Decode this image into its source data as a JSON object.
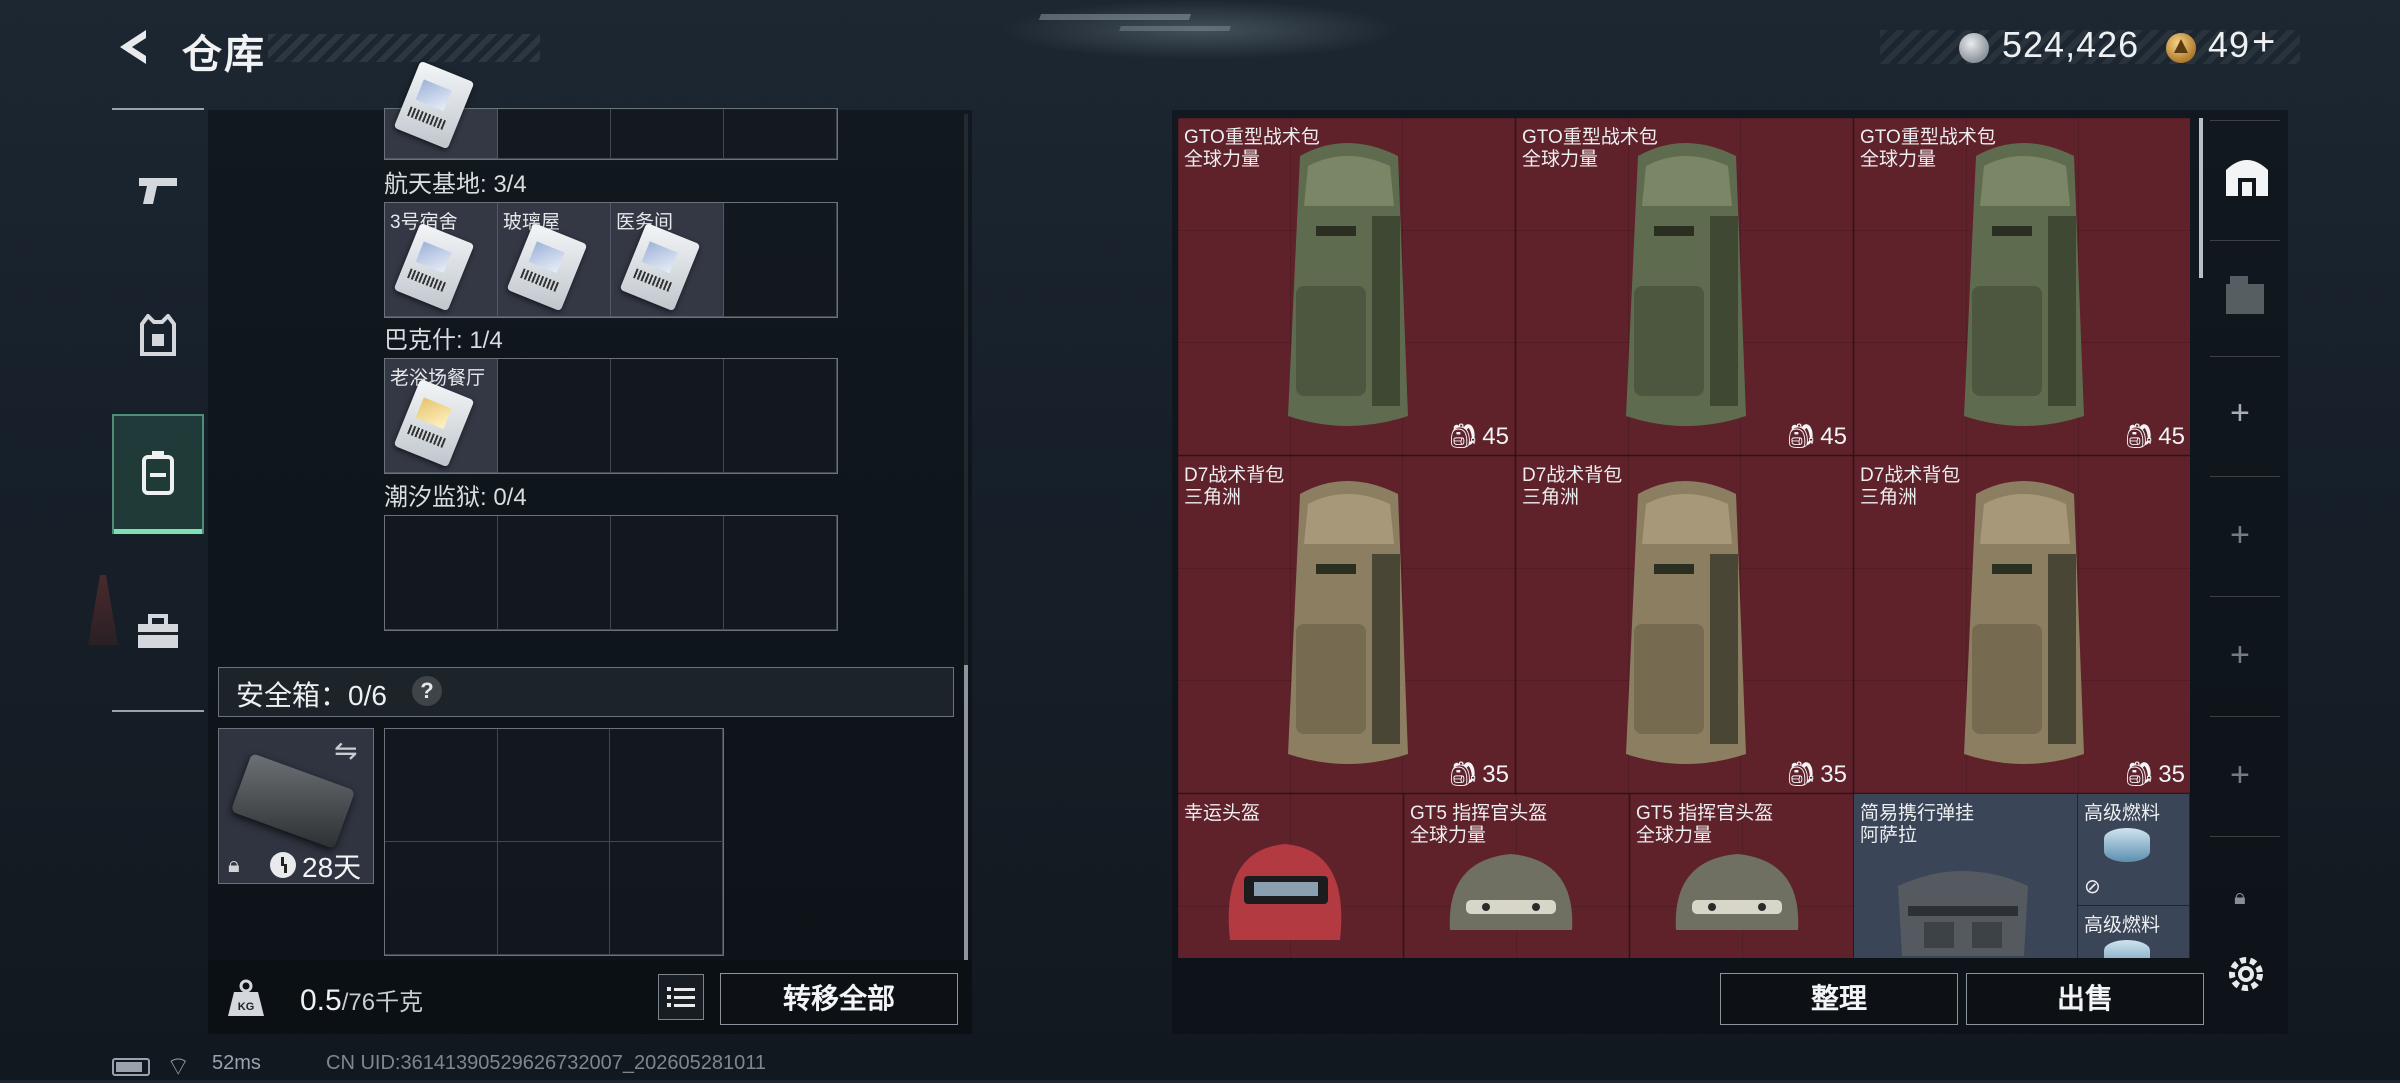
{
  "header": {
    "title": "仓库",
    "currency1": "524,426",
    "currency2": "49",
    "currency2_plus": "+"
  },
  "nav": {
    "items": [
      "weapon",
      "armor",
      "backpack",
      "toolbox"
    ],
    "active_index": 2
  },
  "left": {
    "groups": [
      {
        "label": "航天基地: 3/4",
        "cells": [
          "3号宿舍",
          "玻璃屋",
          "医务间",
          ""
        ]
      },
      {
        "label": "巴克什: 1/4",
        "cells": [
          "老浴场餐厅",
          "",
          "",
          ""
        ]
      },
      {
        "label": "潮汐监狱: 0/4",
        "cells": [
          "",
          "",
          "",
          ""
        ]
      }
    ],
    "safe": {
      "label": "安全箱：0/6",
      "help": "?",
      "days": "28天"
    },
    "weight": {
      "current": "0.5",
      "max": "/76千克"
    },
    "transfer_all": "转移全部"
  },
  "right": {
    "items": [
      {
        "name": "GTO重型战术包",
        "sub": "全球力量",
        "cap": "45"
      },
      {
        "name": "GTO重型战术包",
        "sub": "全球力量",
        "cap": "45"
      },
      {
        "name": "GTO重型战术包",
        "sub": "全球力量",
        "cap": "45"
      },
      {
        "name": "D7战术背包",
        "sub": "三角洲",
        "cap": "35"
      },
      {
        "name": "D7战术背包",
        "sub": "三角洲",
        "cap": "35"
      },
      {
        "name": "D7战术背包",
        "sub": "三角洲",
        "cap": "35"
      },
      {
        "name": "幸运头盔",
        "sub": "",
        "cap": ""
      },
      {
        "name": "GT5 指挥官头盔",
        "sub": "全球力量",
        "cap": ""
      },
      {
        "name": "GT5 指挥官头盔",
        "sub": "全球力量",
        "cap": ""
      },
      {
        "name": "简易携行弹挂",
        "sub": "阿萨拉",
        "cap": ""
      },
      {
        "name": "高级燃料",
        "sub": "",
        "cap": ""
      },
      {
        "name": "高级燃料",
        "sub": "",
        "cap": ""
      }
    ],
    "sort_label": "整理",
    "sell_label": "出售"
  },
  "status": {
    "ping": "52ms",
    "uid": "CN UID:36141390529626732007_202605281011"
  },
  "colors": {
    "item_bg": "#60222a",
    "accent": "#7fe0b4"
  }
}
